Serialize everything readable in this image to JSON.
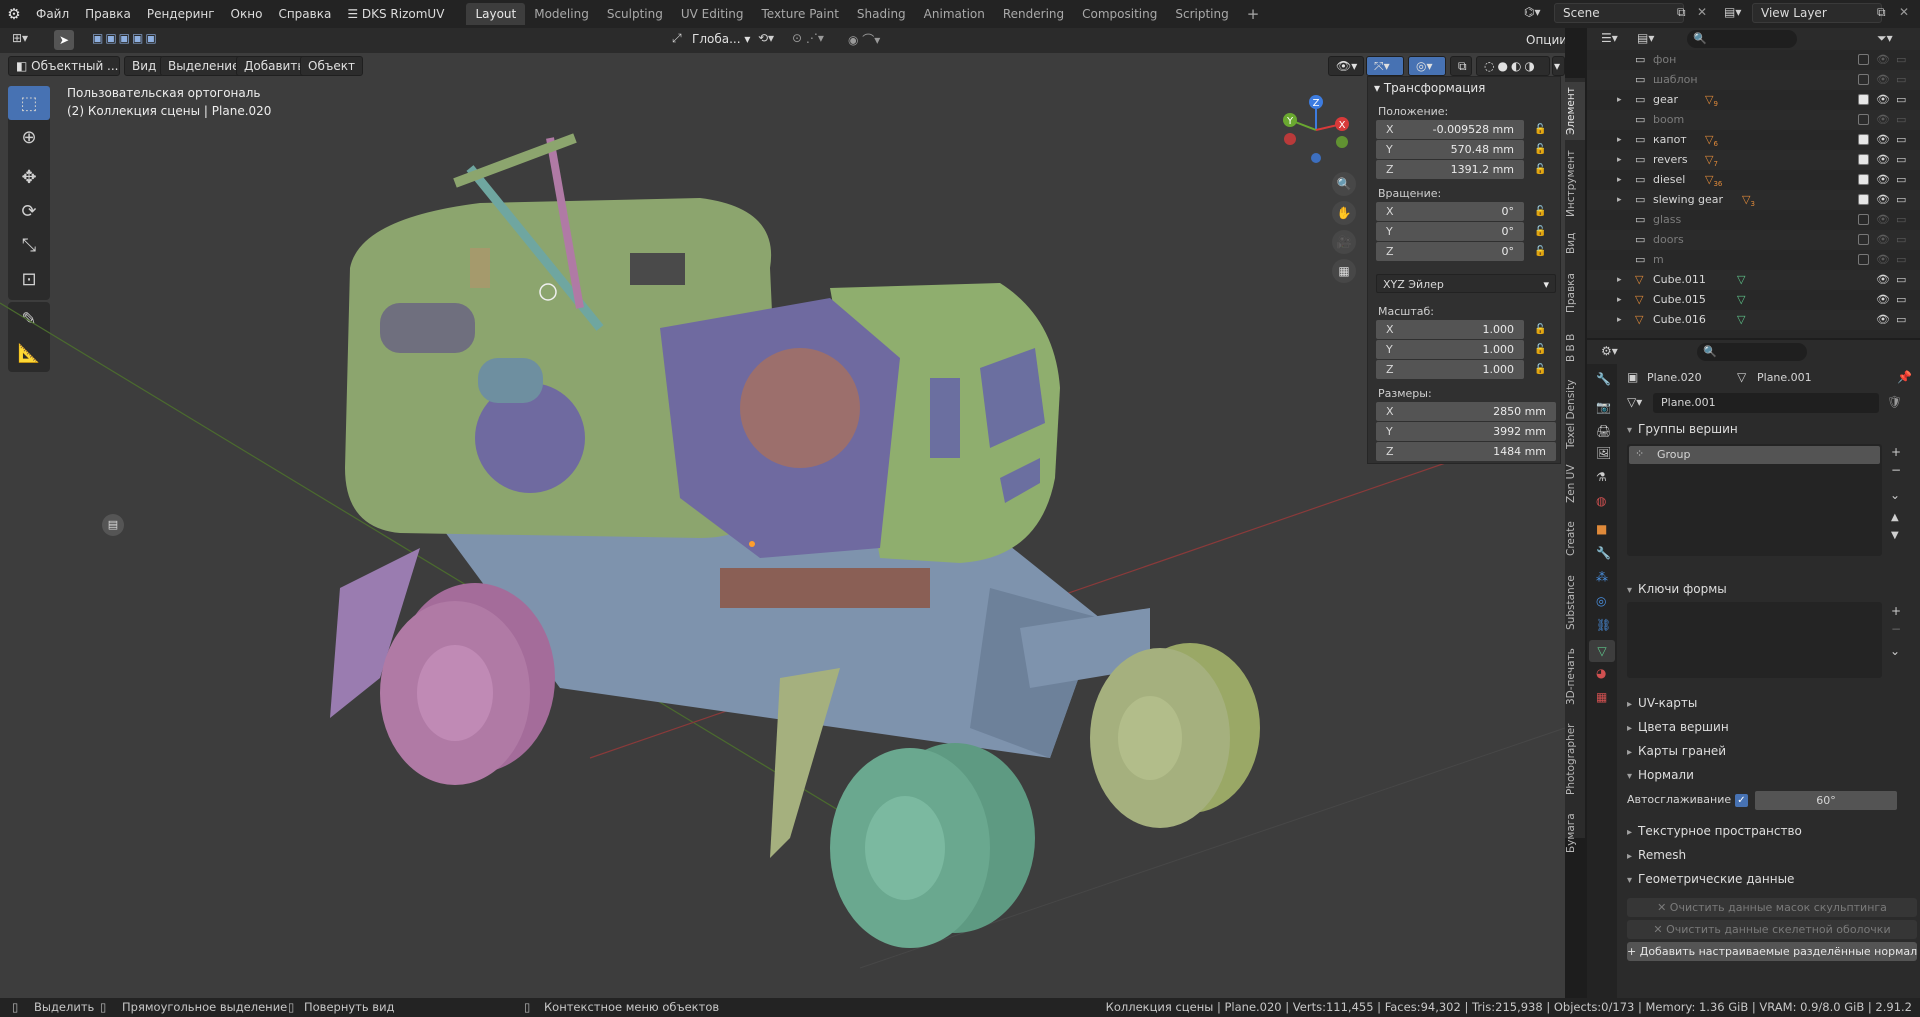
{
  "topbar": {
    "menus": [
      "Файл",
      "Правка",
      "Рендеринг",
      "Окно",
      "Справка",
      "DKS RizomUV"
    ],
    "workspaces": [
      "Layout",
      "Modeling",
      "Sculpting",
      "UV Editing",
      "Texture Paint",
      "Shading",
      "Animation",
      "Rendering",
      "Compositing",
      "Scripting"
    ],
    "active_workspace": "Layout",
    "scene": "Scene",
    "view_layer": "View Layer"
  },
  "viewport_header": {
    "mode": "Объектный ...",
    "menus": [
      "Вид",
      "Выделение",
      "Добавить",
      "Объект"
    ],
    "orientation": "Глоба...",
    "options": "Опции"
  },
  "viewport_info": {
    "view_name": "Пользовательская ортогональ",
    "collection": "(2) Коллекция сцены | Plane.020"
  },
  "transform_panel": {
    "title": "Трансформация",
    "location_label": "Положение:",
    "location": {
      "x": "-0.009528 mm",
      "y": "570.48 mm",
      "z": "1391.2 mm"
    },
    "rotation_label": "Вращение:",
    "rotation": {
      "x": "0°",
      "y": "0°",
      "z": "0°"
    },
    "rotation_mode": "XYZ Эйлер",
    "scale_label": "Масштаб:",
    "scale": {
      "x": "1.000",
      "y": "1.000",
      "z": "1.000"
    },
    "dimensions_label": "Размеры:",
    "dimensions": {
      "x": "2850 mm",
      "y": "3992 mm",
      "z": "1484 mm"
    },
    "axis_labels": {
      "x": "X",
      "y": "Y",
      "z": "Z"
    }
  },
  "side_tabs": [
    "Элемент",
    "Инструмент",
    "Вид",
    "Правка",
    "B B B",
    "Texel Density",
    "Zen UV",
    "Create",
    "Substance",
    "3D-печать",
    "Photographer",
    "Бумага"
  ],
  "gizmo": {
    "x": "X",
    "y": "Y",
    "z": "Z"
  },
  "outliner": {
    "rows": [
      {
        "name": "фон",
        "type": "collection",
        "dim": true,
        "badge": ""
      },
      {
        "name": "шаблон",
        "type": "collection",
        "dim": true,
        "badge": ""
      },
      {
        "name": "gear",
        "type": "collection",
        "dim": false,
        "badge": "9"
      },
      {
        "name": "boom",
        "type": "collection",
        "dim": true,
        "badge": ""
      },
      {
        "name": "капот",
        "type": "collection",
        "dim": false,
        "badge": "6"
      },
      {
        "name": "revers",
        "type": "collection",
        "dim": false,
        "badge": "7"
      },
      {
        "name": "diesel",
        "type": "collection",
        "dim": false,
        "badge": "36"
      },
      {
        "name": "slewing gear",
        "type": "collection",
        "dim": false,
        "badge": "3"
      },
      {
        "name": "glass",
        "type": "collection",
        "dim": true,
        "badge": ""
      },
      {
        "name": "doors",
        "type": "collection",
        "dim": true,
        "badge": ""
      },
      {
        "name": "m",
        "type": "collection",
        "dim": true,
        "badge": ""
      },
      {
        "name": "Cube.011",
        "type": "mesh",
        "dim": false,
        "badge": ""
      },
      {
        "name": "Cube.015",
        "type": "mesh",
        "dim": false,
        "badge": ""
      },
      {
        "name": "Cube.016",
        "type": "mesh",
        "dim": false,
        "badge": ""
      }
    ]
  },
  "properties": {
    "object": "Plane.020",
    "mesh": "Plane.001",
    "mesh_field": "Plane.001",
    "vertex_groups_title": "Группы вершин",
    "vertex_group": "Group",
    "shape_keys_title": "Ключи формы",
    "sections": [
      "UV-карты",
      "Цвета вершин",
      "Карты граней",
      "Нормали"
    ],
    "autosmooth_label": "Автосглаживание",
    "autosmooth_value": "60°",
    "sections2": [
      "Текстурное пространство",
      "Remesh",
      "Геометрические данные"
    ],
    "btn_clear_sculpt": "Очистить данные масок скульптинга",
    "btn_clear_skin": "Очистить данные скелетной оболочки",
    "btn_add_normals": "Добавить настраиваемые разделённые нормали"
  },
  "statusbar": {
    "select": "Выделить",
    "box_select": "Прямоугольное выделение",
    "rotate_view": "Повернуть вид",
    "context_menu": "Контекстное меню объектов",
    "stats": "Коллекция сцены | Plane.020 | Verts:111,455 | Faces:94,302 | Tris:215,938 | Objects:0/173 | Memory: 1.36 GiB | VRAM: 0.9/8.0 GiB | 2.91.2"
  },
  "colors": {
    "accent": "#4772b3",
    "viewport_bg": "#3d3d3d",
    "body_green": "#8ca56e",
    "wheels_pink": "#b07aa5",
    "wheels_teal": "#6aa88f",
    "frame_blue": "#7e93ad"
  }
}
